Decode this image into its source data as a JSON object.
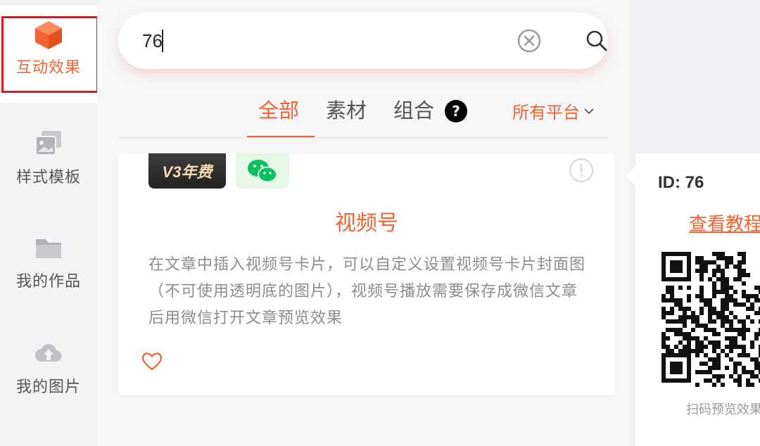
{
  "sidebar": {
    "items": [
      {
        "label": "互动效果",
        "icon": "cube-icon",
        "active": true
      },
      {
        "label": "样式模板",
        "icon": "template-icon",
        "active": false
      },
      {
        "label": "我的作品",
        "icon": "folder-icon",
        "active": false
      },
      {
        "label": "我的图片",
        "icon": "cloud-upload-icon",
        "active": false
      }
    ]
  },
  "search": {
    "value": "76",
    "clear_icon": "clear-icon",
    "search_icon": "search-icon"
  },
  "tabs": {
    "items": [
      {
        "label": "全部",
        "active": true
      },
      {
        "label": "素材",
        "active": false
      },
      {
        "label": "组合",
        "active": false
      }
    ],
    "help_symbol": "?",
    "platform_filter": "所有平台"
  },
  "card": {
    "badge_v3": "V3年费",
    "title": "视频号",
    "description": "在文章中插入视频号卡片，可以自定义设置视频号卡片封面图（不可使用透明底的图片），视频号播放需要保存成微信文章后用微信打开文章预览效果"
  },
  "popover": {
    "id_text": "ID: 76",
    "tutorial_link": "查看教程",
    "caption": "扫码预览效果"
  },
  "colors": {
    "accent": "#f4622f",
    "active_outline": "#e8121a",
    "wechat_green": "#07c160"
  }
}
